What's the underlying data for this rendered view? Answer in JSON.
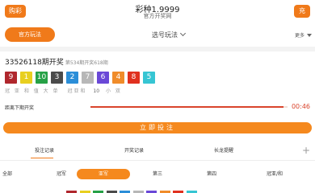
{
  "header": {
    "left_button": "购彩大厅",
    "title": "彩种1.9999",
    "subtitle": "官方开奖网",
    "right_button": "充值"
  },
  "selector": {
    "play_button": "官方玩法",
    "dropdown_label": "选号玩法",
    "right_label": "更多"
  },
  "draw": {
    "issue": "33526118期开奖",
    "issue_note": "第534期开奖618期",
    "balls": [
      {
        "value": "9",
        "color": "#b0272d"
      },
      {
        "value": "1",
        "color": "#e8cf1f"
      },
      {
        "value": "10",
        "color": "#26a146"
      },
      {
        "value": "3",
        "color": "#4b4b4b"
      },
      {
        "value": "2",
        "color": "#2b8ed8"
      },
      {
        "value": "7",
        "color": "#b7b7b7"
      },
      {
        "value": "6",
        "color": "#6a48d7"
      },
      {
        "value": "4",
        "color": "#f08c2a"
      },
      {
        "value": "8",
        "color": "#e0311f"
      },
      {
        "value": "5",
        "color": "#36c5d3"
      }
    ],
    "sum_label": "冠 亚 和 值 大 单",
    "sum_prefix": "冠亚和",
    "sum_value": "10",
    "sum_suffix": "小 双"
  },
  "countdown": {
    "label": "距离下期开奖",
    "time": "00:46",
    "progress": 0.98
  },
  "main_button": "立即投注",
  "tabs": [
    {
      "label": "投注记录",
      "active": true
    },
    {
      "label": "开奖记录",
      "active": false
    },
    {
      "label": "长龙提醒",
      "active": false
    }
  ],
  "tab_plus": "+",
  "filters": [
    {
      "label": "全部",
      "active": false
    },
    {
      "label": "冠军",
      "active": false
    },
    {
      "label": "亚军",
      "active": true
    },
    {
      "label": "第三",
      "active": false
    },
    {
      "label": "第四",
      "active": false
    },
    {
      "label": "冠亚/和",
      "active": false
    }
  ],
  "swatch_colors": [
    "#b0272d",
    "#e8cf1f",
    "#26a146",
    "#4b4b4b",
    "#2b8ed8",
    "#b7b7b7",
    "#6a48d7",
    "#f08c2a",
    "#e0311f",
    "#36c5d3"
  ]
}
